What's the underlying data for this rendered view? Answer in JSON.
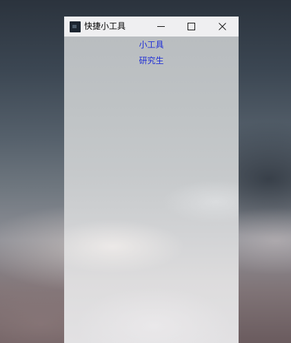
{
  "window": {
    "title": "快捷小工具",
    "icon": "app-icon"
  },
  "controls": {
    "minimize_icon": "minimize-icon",
    "maximize_icon": "maximize-icon",
    "close_icon": "close-icon"
  },
  "links": [
    {
      "label": "小工具"
    },
    {
      "label": "研究生"
    }
  ],
  "colors": {
    "titlebar": "#efeff1",
    "link": "#1f2ed6"
  }
}
